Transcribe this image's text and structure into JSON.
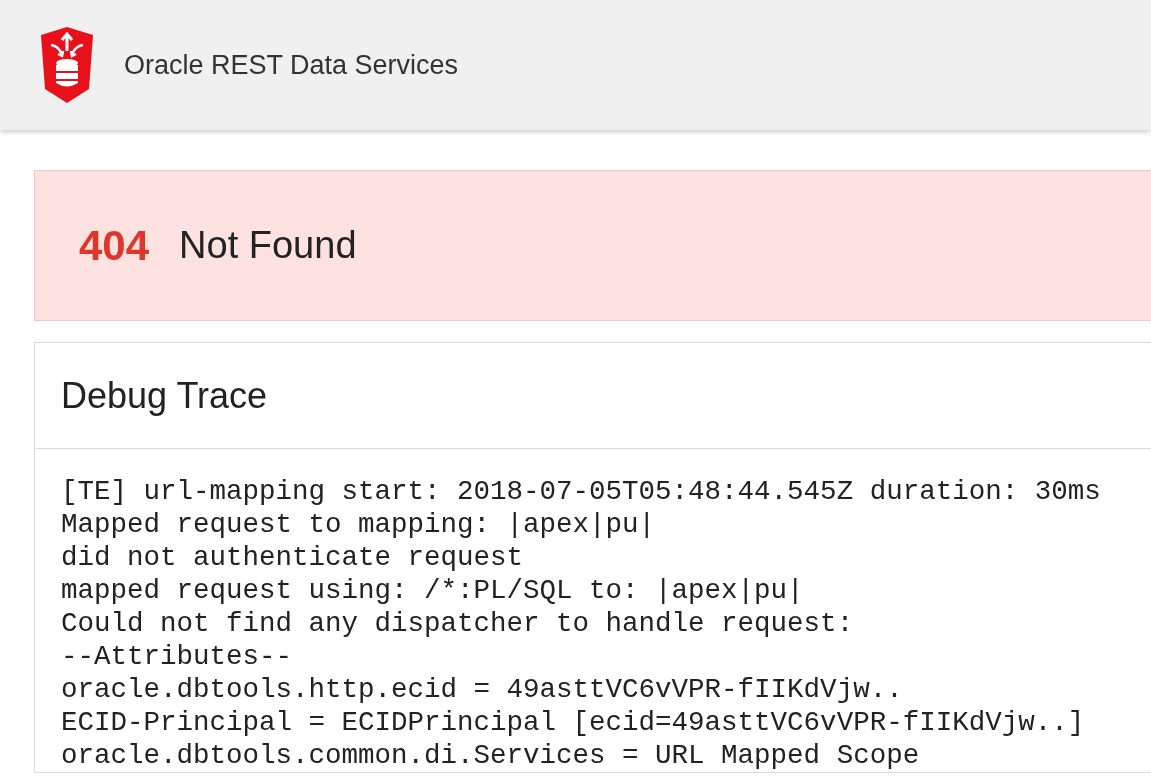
{
  "header": {
    "title": "Oracle REST Data Services"
  },
  "error": {
    "code": "404",
    "message": "Not Found"
  },
  "debug": {
    "title": "Debug Trace",
    "lines": [
      "[TE] url-mapping start: 2018-07-05T05:48:44.545Z duration: 30ms",
      "Mapped request to mapping: |apex|pu|",
      "did not authenticate request",
      "mapped request using: /*:PL/SQL to: |apex|pu|",
      "Could not find any dispatcher to handle request:",
      "--Attributes--",
      "oracle.dbtools.http.ecid = 49asttVC6vVPR-fIIKdVjw..",
      "ECID-Principal = ECIDPrincipal [ecid=49asttVC6vVPR-fIIKdVjw..]",
      "oracle.dbtools.common.di.Services = URL Mapped Scope"
    ]
  }
}
